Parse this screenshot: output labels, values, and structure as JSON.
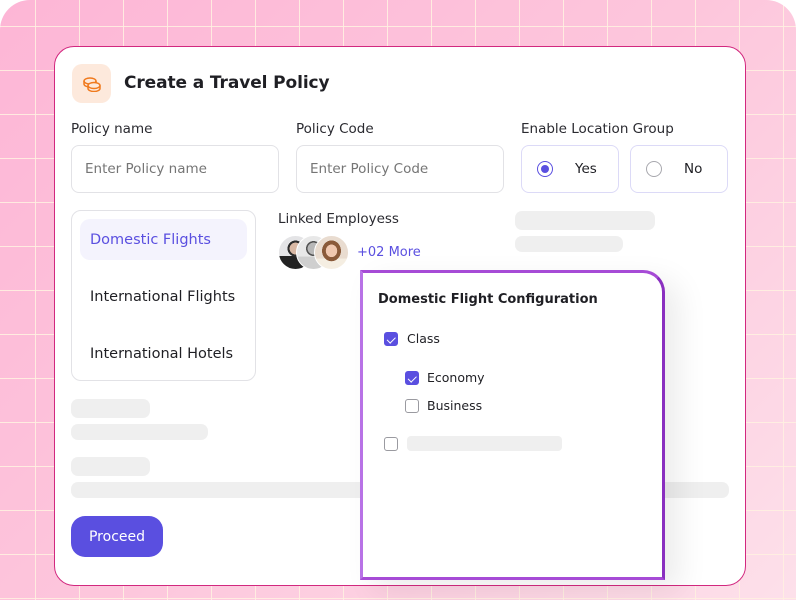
{
  "header": {
    "title": "Create a Travel Policy",
    "icon": "coins-icon"
  },
  "form": {
    "policy_name": {
      "label": "Policy name",
      "placeholder": "Enter Policy name",
      "value": ""
    },
    "policy_code": {
      "label": "Policy Code",
      "placeholder": "Enter Policy Code",
      "value": ""
    },
    "location_group": {
      "label": "Enable Location Group",
      "options": [
        {
          "label": "Yes",
          "selected": true
        },
        {
          "label": "No",
          "selected": false
        }
      ]
    }
  },
  "categories": [
    {
      "label": "Domestic Flights",
      "active": true
    },
    {
      "label": "International Flights",
      "active": false
    },
    {
      "label": "International  Hotels",
      "active": false
    }
  ],
  "linked_employees": {
    "label": "Linked Employess",
    "more": "+02 More",
    "avatar_count": 3
  },
  "config_popup": {
    "title": "Domestic Flight Configuration",
    "items": [
      {
        "label": "Class",
        "checked": true
      },
      {
        "label": "Economy",
        "checked": true
      },
      {
        "label": "Business",
        "checked": false
      }
    ]
  },
  "actions": {
    "proceed": "Proceed"
  },
  "colors": {
    "accent": "#5a4fe0",
    "card_border": "#d2287f",
    "popup_border": "#a64bd6",
    "background": "#fdc1db"
  }
}
